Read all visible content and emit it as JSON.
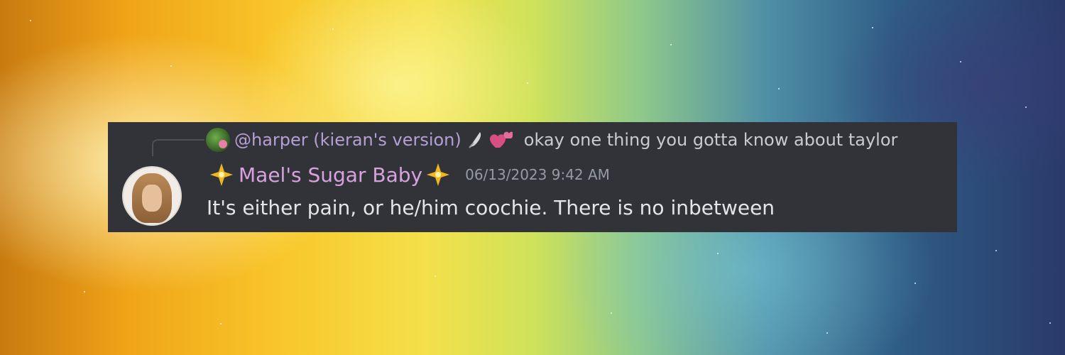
{
  "reply": {
    "username": "@harper (kieran's version)",
    "text": "okay one thing you gotta know about taylor"
  },
  "message": {
    "username": "Mael's Sugar Baby",
    "timestamp": "06/13/2023 9:42 AM",
    "text": "It's either pain, or he/him coochie. There is no inbetween"
  },
  "colors": {
    "panel_bg": "#313338",
    "reply_username": "#b79fd6",
    "username": "#d7a2dd",
    "timestamp": "#949ba4",
    "message_text": "#e3e5e8"
  },
  "icons": {
    "reply_avatar": "avatar-icon",
    "feather": "feather-icon",
    "hearts": "hearts-icon",
    "sparkle": "sparkle-icon",
    "main_avatar": "avatar-icon"
  }
}
